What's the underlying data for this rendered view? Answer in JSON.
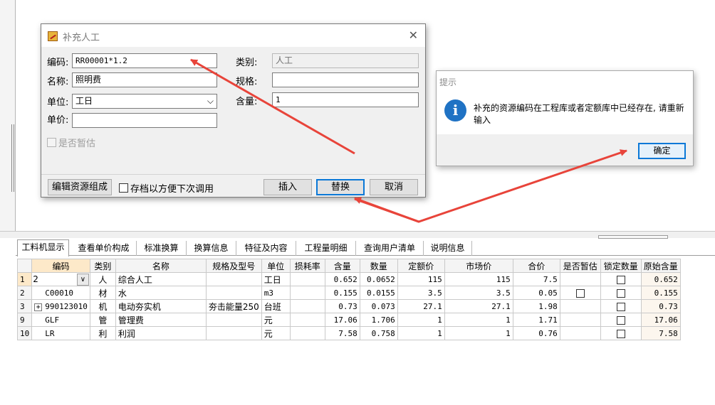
{
  "dialog": {
    "title": "补充人工",
    "code_label": "编码:",
    "code_value": "RR00001*1.2",
    "name_label": "名称:",
    "name_value": "照明费",
    "unit_label": "单位:",
    "unit_value": "工日",
    "price_label": "单价:",
    "price_value": "",
    "category_label": "类别:",
    "category_value": "人工",
    "spec_label": "规格:",
    "spec_value": "",
    "content_label": "含量:",
    "content_value": "1",
    "provisional_label": "是否暂估",
    "edit_composition_btn": "编辑资源组成",
    "save_for_later_label": "存档以方便下次调用",
    "insert_btn": "插入",
    "replace_btn": "替换",
    "cancel_btn": "取消"
  },
  "msgbox": {
    "title": "提示",
    "message": "补充的资源编码在工程库或者定额库中已经存在, 请重新输入",
    "ok_btn": "确定"
  },
  "tabs": [
    "工料机显示",
    "查看单价构成",
    "标准换算",
    "换算信息",
    "特征及内容",
    "工程量明细",
    "查询用户清单",
    "说明信息"
  ],
  "table": {
    "headers": [
      "",
      "编码",
      "类别",
      "名称",
      "规格及型号",
      "单位",
      "损耗率",
      "含量",
      "数量",
      "定额价",
      "市场价",
      "合价",
      "是否暂估",
      "锁定数量",
      "原始含量"
    ],
    "rows": [
      {
        "rn": "1",
        "code": "2",
        "cat": "人",
        "name": "综合人工",
        "spec": "",
        "unit": "工日",
        "loss": "",
        "qty_content": "0.652",
        "qty": "0.0652",
        "quota_price": "115",
        "market_price": "115",
        "total": "7.5",
        "orig": "0.652"
      },
      {
        "rn": "2",
        "code": "C00010",
        "cat": "材",
        "name": "水",
        "spec": "",
        "unit": "m3",
        "loss": "",
        "qty_content": "0.155",
        "qty": "0.0155",
        "quota_price": "3.5",
        "market_price": "3.5",
        "total": "0.05",
        "orig": "0.155"
      },
      {
        "rn": "3",
        "code": "990123010",
        "cat": "机",
        "name": "电动夯实机",
        "spec": "夯击能量250",
        "unit": "台班",
        "loss": "",
        "qty_content": "0.73",
        "qty": "0.073",
        "quota_price": "27.1",
        "market_price": "27.1",
        "total": "1.98",
        "orig": "0.73"
      },
      {
        "rn": "9",
        "code": "GLF",
        "cat": "管",
        "name": "管理费",
        "spec": "",
        "unit": "元",
        "loss": "",
        "qty_content": "17.06",
        "qty": "1.706",
        "quota_price": "1",
        "market_price": "1",
        "total": "1.71",
        "orig": "17.06"
      },
      {
        "rn": "10",
        "code": "LR",
        "cat": "利",
        "name": "利润",
        "spec": "",
        "unit": "元",
        "loss": "",
        "qty_content": "7.58",
        "qty": "0.758",
        "quota_price": "1",
        "market_price": "1",
        "total": "0.76",
        "orig": "7.58"
      }
    ]
  },
  "colors": {
    "accent": "#0a78d7",
    "annotation_arrow": "#e8443a",
    "info_icon": "#1f72c4",
    "selected_header": "#fde9c9"
  }
}
